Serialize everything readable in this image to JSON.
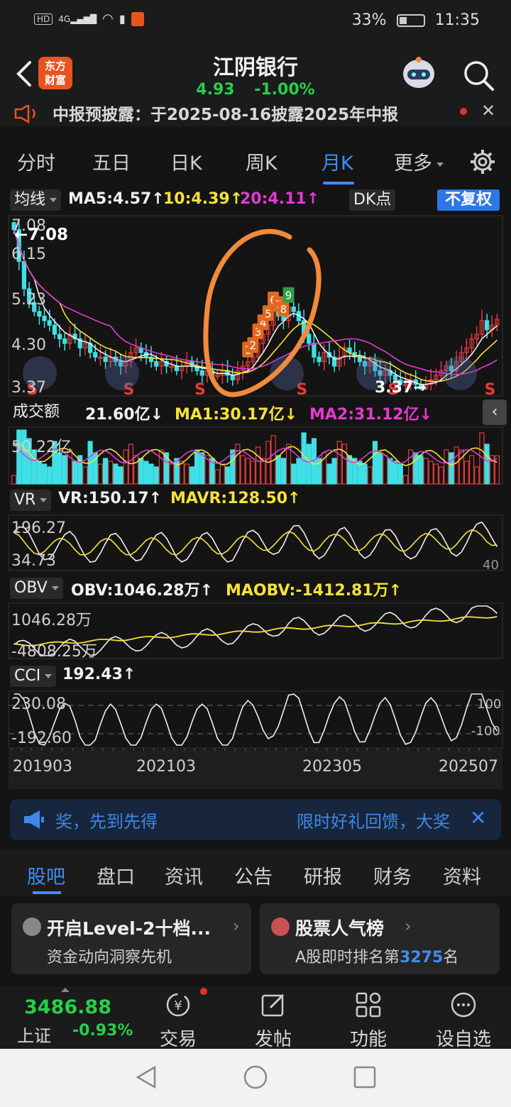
{
  "status_bar": {
    "left_chip": "HD",
    "signal": "4G",
    "battery_percent": "33%",
    "battery_level": 0.33,
    "time": "11:35"
  },
  "header": {
    "title": "江阴银行",
    "price": "4.93",
    "change": "-1.00%",
    "logo_line1": "东方",
    "logo_line2": "财富"
  },
  "notice": {
    "text": "中报预披露：于2025-08-16披露2025年中报"
  },
  "tabs": [
    "分时",
    "五日",
    "日K",
    "周K",
    "月K",
    "更多"
  ],
  "active_tab": "月K",
  "ma_panel": {
    "selector": "均线",
    "ma5": "MA5:4.57↑",
    "ma10": "10:4.39↑",
    "ma20": "20:4.11↑",
    "dk_button": "DK点",
    "adjust_button": "不复权",
    "y_labels": [
      "7.08",
      "6.15",
      "5.23",
      "4.30",
      "3.37"
    ],
    "high_marker": "←7.08",
    "low_marker": "3.37→",
    "signal_labels": [
      "S",
      "S",
      "S",
      "S",
      "S",
      "S"
    ],
    "sequence_numbers": [
      "1",
      "2",
      "3",
      "4",
      "5",
      "6",
      "7",
      "8",
      "9"
    ]
  },
  "volume_panel": {
    "selector": "成交额",
    "value": "21.60亿↓",
    "ma1": "MA1:30.17亿↓",
    "ma2": "MA2:31.12亿↓",
    "y_label": "50.22亿"
  },
  "vr_panel": {
    "selector": "VR",
    "vr": "VR:150.17↑",
    "mavr": "MAVR:128.50↑",
    "y_top": "196.27",
    "y_bottom": "34.73",
    "ref": "40"
  },
  "obv_panel": {
    "selector": "OBV",
    "obv": "OBV:1046.28万↑",
    "maobv": "MAOBV:-1412.81万↑",
    "y_top": "1046.28万",
    "y_bottom": "-4808.25万"
  },
  "cci_panel": {
    "selector": "CCI",
    "cci": "192.43↑",
    "y_top": "230.08",
    "y_bottom": "-192.60",
    "ref_top": "100",
    "ref_bottom": "-100"
  },
  "x_axis": [
    "201903",
    "202103",
    "202305",
    "202507"
  ],
  "banner": {
    "left_text": "奖，先到先得",
    "right_text": "限时好礼回馈，大奖"
  },
  "bottom_tabs": [
    "股吧",
    "盘口",
    "资讯",
    "公告",
    "研报",
    "财务",
    "资料"
  ],
  "active_bottom_tab": "股吧",
  "cards": [
    {
      "title": "开启Level-2十档...",
      "subtitle": "资金动向洞察先机"
    },
    {
      "title": "股票人气榜",
      "subtitle_prefix": "A股即时排名第",
      "rank": "3275",
      "subtitle_suffix": "名"
    }
  ],
  "bottom_nav": {
    "index_value": "3486.88",
    "index_name": "上证",
    "index_change": "-0.93%",
    "items": [
      "交易",
      "发帖",
      "功能",
      "设自选"
    ]
  },
  "colors": {
    "up": "#e23b3b",
    "down": "#3ee0e6",
    "accent": "#3f8ef7",
    "green": "#25d04b",
    "ma5": "#f0f0f0",
    "ma10": "#f6e237",
    "ma20": "#e33ad1"
  },
  "chart_data": {
    "type": "candlestick",
    "period": "monthly",
    "x_ticks": [
      "201903",
      "202103",
      "202305",
      "202507"
    ],
    "price_range": [
      3.37,
      7.08
    ],
    "close_series": [
      6.9,
      6.2,
      5.6,
      5.3,
      5.1,
      5.0,
      4.9,
      4.8,
      4.6,
      4.5,
      4.4,
      4.6,
      4.5,
      4.3,
      4.4,
      4.2,
      4.1,
      4.1,
      4.0,
      4.1,
      4.0,
      3.9,
      4.0,
      4.2,
      4.3,
      4.2,
      4.1,
      4.0,
      3.9,
      4.0,
      3.9,
      3.9,
      3.8,
      3.9,
      4.0,
      3.9,
      3.8,
      3.7,
      3.8,
      3.7,
      3.7,
      3.8,
      3.7,
      3.6,
      3.8,
      3.9,
      4.0,
      4.1,
      4.4,
      4.6,
      4.8,
      5.1,
      5.0,
      4.9,
      5.2,
      5.1,
      4.9,
      4.6,
      4.4,
      4.1,
      4.0,
      4.2,
      4.1,
      3.9,
      4.1,
      4.3,
      4.2,
      4.1,
      4.0,
      3.9,
      4.0,
      3.8,
      3.7,
      3.8,
      3.7,
      3.6,
      3.5,
      3.5,
      3.6,
      3.5,
      3.4,
      3.5,
      3.6,
      3.7,
      3.8,
      3.9,
      3.8,
      4.0,
      4.2,
      4.3,
      4.5,
      4.6,
      4.9,
      4.7,
      4.8,
      4.93
    ],
    "volume": {
      "latest": "21.60亿",
      "ma1": "30.17亿",
      "ma2": "31.12亿",
      "max_label": "50.22亿"
    },
    "vr": {
      "value": 150.17,
      "mavr": 128.5,
      "range": [
        34.73,
        196.27
      ]
    },
    "obv": {
      "value": "1046.28万",
      "maobv": "-1412.81万",
      "range": [
        "-4808.25万",
        "1046.28万"
      ]
    },
    "cci": {
      "value": 192.43,
      "range": [
        -192.6,
        230.08
      ],
      "reference": [
        -100,
        100
      ]
    }
  }
}
